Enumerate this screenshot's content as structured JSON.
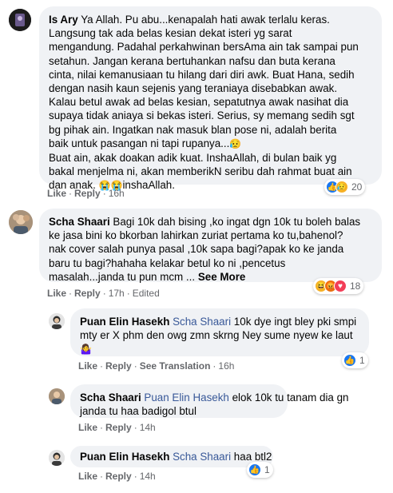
{
  "comments": [
    {
      "author": "Is Ary",
      "lines": [
        "Ya Allah. Pu abu...kenapalah hati awak terlalu keras.",
        "Langsung tak ada belas kesian dekat isteri yg sarat",
        "mengandung. Padahal perkahwinan bersAma ain tak sampai pun",
        "setahun. Jangan kerana bertuhankan nafsu dan buta kerana",
        "cinta, nilai kemanusiaan tu hilang dari diri awk. Buat Hana, sedih",
        "dengan nasih kaun sejenis yang teraniaya disebabkan awak.",
        "Kalau betul awak ad belas kesian, sepatutnya awak nasihat dia",
        "supaya tidak aniaya si bekas isteri. Serius, sy memang sedih sgt",
        "bg pihak ain. Ingatkan nak masuk blan pose ni, adalah berita",
        "baik untuk pasangan ni tapi rupanya...",
        "Buat ain, akak doakan adik kuat. InshaAllah, di bulan baik yg",
        "bakal menjelma ni, akan memberikN seribu dah rahmat buat ain",
        "dan anak.",
        "inshaAllah."
      ],
      "like": "Like",
      "reply": "Reply",
      "time": "16h",
      "reaction_count": "20",
      "reaction_icons": [
        "like-icon",
        "sad-icon"
      ]
    },
    {
      "author": "Scha Shaari",
      "lines": [
        "Bagi 10k dah bising ,ko ingat dgn 10k tu boleh balas",
        "ke jasa bini ko bkorban lahirkan zuriat pertama ko tu,bahenol?",
        "nak cover salah punya pasal ,10k sapa bagi?apak ko ke janda",
        "baru tu bagi?hahaha kelakar betul ko ni ,pencetus",
        "masalah...janda tu pun mcm ..."
      ],
      "see_more": "See More",
      "like": "Like",
      "reply": "Reply",
      "time": "17h",
      "edited": "Edited",
      "reaction_count": "18",
      "reaction_icons": [
        "haha-icon",
        "angry-icon",
        "love-icon"
      ]
    }
  ],
  "replies": [
    {
      "author": "Puan Elin Hasekh",
      "mention": "Scha Shaari",
      "lines": [
        "10k dye ingt bley pki smpi",
        "mty er X phm den owg zmn skrng Ney sume nyew ke laut"
      ],
      "like": "Like",
      "reply": "Reply",
      "see_translation": "See Translation",
      "time": "16h",
      "reaction_count": "1",
      "reaction_icons": [
        "like-icon"
      ]
    },
    {
      "author": "Scha Shaari",
      "mention": "Puan Elin Hasekh",
      "lines": [
        "elok 10k tu tanam dia gn",
        "janda tu haa badigol btul"
      ],
      "like": "Like",
      "reply": "Reply",
      "time": "14h"
    },
    {
      "author": "Puan Elin Hasekh",
      "mention": "Scha Shaari",
      "lines": [
        "haa btl2"
      ],
      "like": "Like",
      "reply": "Reply",
      "time": "14h",
      "reaction_count": "1",
      "reaction_icons": [
        "like-icon"
      ]
    }
  ],
  "colors": {
    "bubble": "#f0f2f5",
    "link": "#385898",
    "meta": "#65676b",
    "like_blue": "#1877f2",
    "love_red": "#f33e58",
    "haha_yellow": "#f7b125"
  }
}
